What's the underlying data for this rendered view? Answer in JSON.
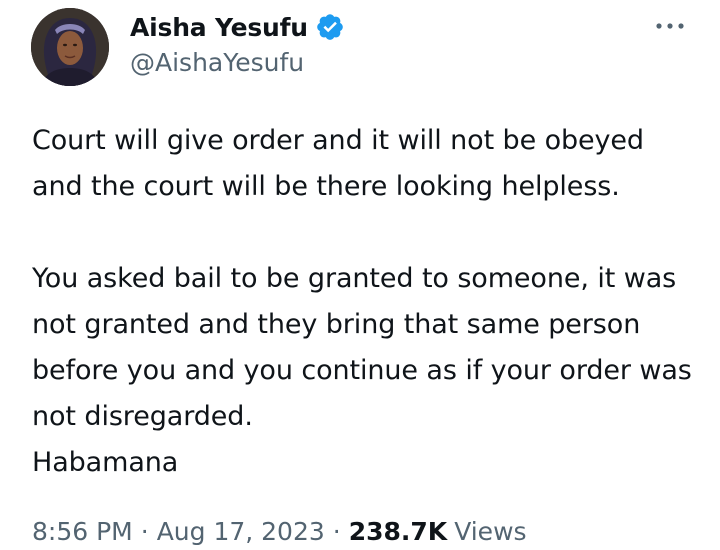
{
  "author": {
    "display_name": "Aisha Yesufu",
    "handle": "@AishaYesufu",
    "verified": true,
    "avatar_icon": "profile-photo"
  },
  "tweet": {
    "text": "Court will give order and it will not be obeyed and the court will be there looking helpless.\n\nYou asked bail to be granted to someone, it was not granted and they bring that same person before you and you continue as if your order was not disregarded.\nHabamana",
    "time": "8:56 PM",
    "date": "Aug 17, 2023",
    "separator": "·",
    "views_count": "238.7K",
    "views_label": "Views"
  },
  "icons": {
    "verified": "verified-badge-icon",
    "more": "more-options-icon"
  },
  "colors": {
    "text_primary": "#0f1419",
    "text_secondary": "#536471",
    "verified_blue": "#1d9bf0"
  }
}
